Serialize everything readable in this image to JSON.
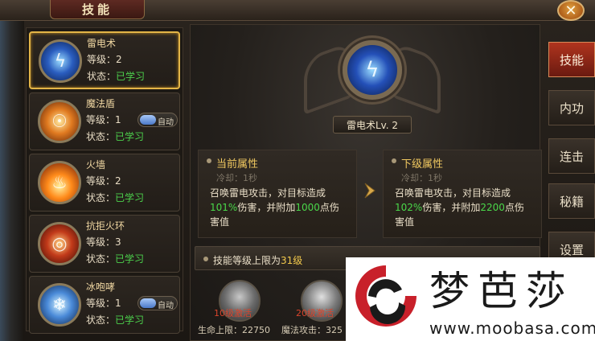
{
  "window": {
    "title": "技能",
    "close_symbol": "✕"
  },
  "skills": [
    {
      "name": "雷电术",
      "level_label": "等级：",
      "level": "2",
      "state_label": "状态：",
      "state": "已学习",
      "selected": true,
      "icon": "lightning-icon"
    },
    {
      "name": "魔法盾",
      "level_label": "等级：",
      "level": "1",
      "state_label": "状态：",
      "state": "已学习",
      "auto": "自动",
      "icon": "magic-shield-icon"
    },
    {
      "name": "火墙",
      "level_label": "等级：",
      "level": "2",
      "state_label": "状态：",
      "state": "已学习",
      "icon": "fire-wall-icon"
    },
    {
      "name": "抗拒火环",
      "level_label": "等级：",
      "level": "3",
      "state_label": "状态：",
      "state": "已学习",
      "icon": "repel-ring-icon"
    },
    {
      "name": "冰咆哮",
      "level_label": "等级：",
      "level": "1",
      "state_label": "状态：",
      "state": "已学习",
      "auto": "自动",
      "icon": "ice-roar-icon"
    }
  ],
  "detail": {
    "skill_title": "雷电术Lv. 2",
    "current": {
      "title": "当前属性",
      "cooldown": "冷却：1秒",
      "desc_1": "召唤雷电攻击，对目标造成",
      "pct": "101%",
      "desc_2": "伤害，并附加",
      "extra": "1000",
      "desc_3": "点伤",
      "desc_4": "害值"
    },
    "next": {
      "title": "下级属性",
      "cooldown": "冷却：1秒",
      "desc_1": "召唤雷电攻击，对目标造成",
      "pct": "102%",
      "desc_2": "伤害，并附加",
      "extra": "2200",
      "desc_3": "点伤",
      "desc_4": "害值"
    },
    "limit_prefix": "技能等级上限为",
    "limit_value": "31级",
    "bonus": [
      {
        "label": "10级激活",
        "stat": "生命上限：22750"
      },
      {
        "label": "20级激活",
        "stat": "魔法攻击：325"
      }
    ]
  },
  "tabs": [
    "技能",
    "内功",
    "连击",
    "秘籍",
    "设置"
  ],
  "watermark": {
    "cn": "梦芭莎",
    "url": "www.moobasa.com"
  },
  "colors": {
    "accent_gold": "#e3b547",
    "learned_green": "#4cd14c",
    "active_tab_red": "#b0341e"
  }
}
